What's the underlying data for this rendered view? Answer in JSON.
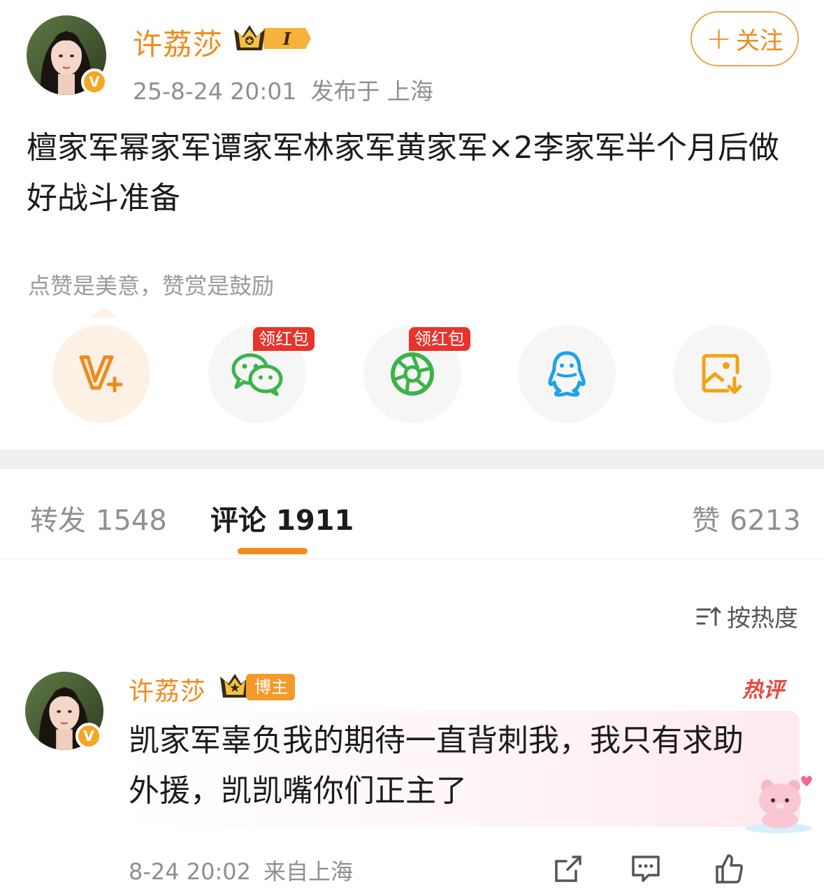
{
  "post": {
    "author": "许荔莎",
    "level_badge": "I",
    "date": "25-8-24 20:01",
    "location": "发布于 上海",
    "follow_label": "关注",
    "text": "檀家军幂家军谭家军林家军黄家军×2李家军半个月后做好战斗准备",
    "reward_hint": "点赞是美意，赞赏是鼓励"
  },
  "share": {
    "items": [
      {
        "icon": "vplus-icon"
      },
      {
        "icon": "wechat-icon",
        "tag": "领红包"
      },
      {
        "icon": "moments-icon",
        "tag": "领红包"
      },
      {
        "icon": "qq-icon"
      },
      {
        "icon": "save-image-icon"
      }
    ]
  },
  "tabs": {
    "repost": {
      "label": "转发",
      "count": "1548"
    },
    "comment": {
      "label": "评论",
      "count": "1911"
    },
    "like": {
      "label": "赞",
      "count": "6213"
    }
  },
  "sort": {
    "label": "按热度"
  },
  "comment": {
    "author": "许荔莎",
    "host_tag": "博主",
    "hot_tag": "热评",
    "text": "凯家军辜负我的期待一直背刺我，我只有求助外援，凯凯嘴你们正主了",
    "time": "8-24 20:02",
    "location": "来自上海"
  },
  "colors": {
    "accent": "#ef8a1e",
    "red_tag": "#e8332c",
    "wechat_green": "#3cb34a",
    "qq_blue": "#1aa3e8"
  }
}
